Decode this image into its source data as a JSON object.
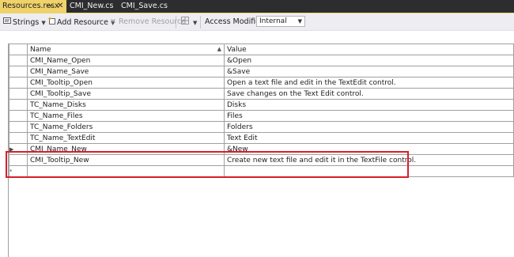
{
  "tabs": {
    "active": {
      "label": "Resources.resx",
      "pin_icon": "pin-icon",
      "close_icon": "close-icon"
    },
    "others": [
      "CMI_New.cs",
      "CMI_Save.cs"
    ]
  },
  "toolbar": {
    "strings_label": "Strings",
    "add_resource_label": "Add Resource",
    "remove_resource_label": "Remove Resource",
    "access_modifier_label": "Access Modifier:",
    "access_modifier_value": "Internal"
  },
  "grid": {
    "columns": {
      "name": "Name",
      "value": "Value"
    },
    "rows": [
      {
        "name": "CMI_Name_Open",
        "value": "&Open"
      },
      {
        "name": "CMI_Name_Save",
        "value": "&Save"
      },
      {
        "name": "CMI_Tooltip_Open",
        "value": "Open a text file and edit in the TextEdit control."
      },
      {
        "name": "CMI_Tooltip_Save",
        "value": "Save changes on the Text Edit control."
      },
      {
        "name": "TC_Name_Disks",
        "value": "Disks"
      },
      {
        "name": "TC_Name_Files",
        "value": "Files"
      },
      {
        "name": "TC_Name_Folders",
        "value": "Folders"
      },
      {
        "name": "TC_Name_TextEdit",
        "value": "Text Edit"
      },
      {
        "name": "CMI_Name_New",
        "value": "&New"
      },
      {
        "name": "CMI_Tooltip_New",
        "value": "Create new text file and edit it in the TextFile control."
      }
    ],
    "new_row_marker": "*",
    "current_row_marker": "▶"
  },
  "colors": {
    "active_tab": "#f0d26a",
    "tab_strip": "#2d2d30",
    "toolbar": "#eeeef2",
    "highlight": "#d81f2a"
  }
}
